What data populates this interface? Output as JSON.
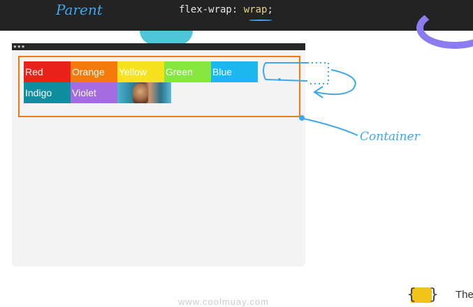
{
  "header": {
    "parent_note": "Parent",
    "code_property": "flex-wrap: ",
    "code_value": "wrap",
    "code_semicolon": ";"
  },
  "browser": {
    "dots": "●●●"
  },
  "flex_items": [
    {
      "label": "Red",
      "color": "#e8231b"
    },
    {
      "label": "Orange",
      "color": "#f57a0c"
    },
    {
      "label": "Yellow",
      "color": "#f6e21d"
    },
    {
      "label": "Green",
      "color": "#86e83e"
    },
    {
      "label": "Blue",
      "color": "#1ab7f0"
    },
    {
      "label": "Indigo",
      "color": "#0f8ea0"
    },
    {
      "label": "Violet",
      "color": "#a56be0"
    }
  ],
  "annotations": {
    "container_note": "Container"
  },
  "footer": {
    "url": "www.coolmuay.com",
    "brand": "The"
  },
  "colors": {
    "container_border": "#f07a12",
    "annotation_blue": "#3ea7ee"
  }
}
